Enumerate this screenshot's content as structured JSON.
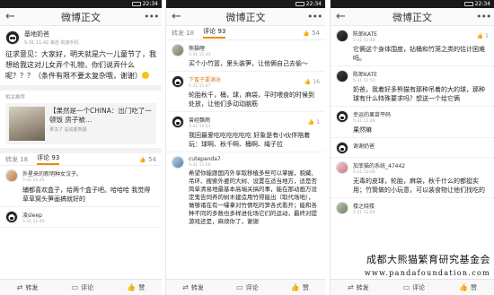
{
  "status_time": "22:34",
  "nav": {
    "title": "微博正文"
  },
  "panel1": {
    "author": {
      "name": "基地奶爸",
      "time": "5-31 11:42  来自 凯旅手机"
    },
    "body": "征求意见：大家好，明天就是六一儿童节了，我想给我这对儿女弄个礼物，你们说弄什么呢？？？（条件有限不要太复杂哦，谢谢）",
    "related_label": "相关推荐",
    "share": {
      "text": "【果然是一个CHINA：出门吃了一顿饭 房子被…",
      "sub": "果冻了 是成都熊猫"
    },
    "tabs": {
      "repost": "转发 18",
      "comment": "评论 93",
      "likes": "54"
    },
    "comments": [
      {
        "name": "外星来的新明种女汉子。",
        "time": "5-31 11:45",
        "text": "",
        "likes": ""
      },
      {
        "name": "",
        "time": "",
        "text": "辅都喜欢盒子，给两个盒子吧。哈哈哈 我觉得草草窝头笋画搞就好的",
        "likes": ""
      },
      {
        "name": "凌sleep",
        "time": "5-31 11:46",
        "text": "",
        "likes": ""
      }
    ]
  },
  "panel2": {
    "tabs": {
      "repost": "转发 18",
      "comment": "评论 93",
      "likes": "54"
    },
    "comments": [
      {
        "name": "熊猫哩",
        "time": "5-31 11:45",
        "text": "买个小竹篮，里头装笋，让他俩自己去偷～",
        "likes": ""
      },
      {
        "name": "下蜜子要满泳",
        "time": "5-31 11:47",
        "text": "",
        "likes": "16"
      },
      {
        "name": "",
        "time": "",
        "text": "轮胎秋千，桶，球，麻袋，平时喂食的时候到处放，让他们多动动脑筋",
        "likes": ""
      },
      {
        "name": "曾经飘雨",
        "time": "5-31 11:51",
        "text": "我回最爱吃吃吃吃吃吃 好象是有小伙伴陪着玩：球啊、秋千啊、桶啊、绳子拉",
        "likes": "1"
      },
      {
        "name": "cutepanda7",
        "time": "5-31 11:56",
        "text": "希望你能跟国内外享取移植多些可以掌握，貌藏、吊环、搜索外婆的大树、设置在适当地方，适是否简单清易地最基本高端关搞的事，能在那动画万设定鬼告饲养的树木建造用竹得能出（取代场地），做够诸在有一嚯拿对竹情吃的笋各式看开；能和各种不同的多数也多样进化场它们的运动，最终对提游戏还是，麻烦你了，谢谢",
        "likes": ""
      }
    ]
  },
  "panel3": {
    "comments": [
      {
        "name": "陈郎KATE",
        "time": "5-31 11:48",
        "text": "它俩这个身体围度，钻桶和竹笼之类的估计困难吗。",
        "likes": "1"
      },
      {
        "name": "陈郎KATE",
        "time": "5-31 11:51",
        "text": "奶爸，我着好多熊猫有那种吊着的大的球，那种球有什么特殊要求吗？想送一个给它俩",
        "likes": ""
      },
      {
        "name": "幸运的果苗平码",
        "time": "5-31 11:48",
        "text": "果然嘛",
        "likes": ""
      },
      {
        "name": "谢谢奶爸",
        "time": "",
        "text": "",
        "likes": ""
      },
      {
        "name": "加菲猫的系统_47442",
        "time": "5-31 12:00",
        "text": "无毒的皮球，轮胎，麻袋，秋千什么的都挺实用；竹筒做的小玩意，可以装食物让他们找吃的",
        "likes": ""
      },
      {
        "name": "楼之晓楼",
        "time": "5-31 12:03",
        "text": "",
        "likes": ""
      }
    ]
  },
  "bottombar": {
    "repost": "转发",
    "comment": "评论",
    "like": "赞"
  },
  "watermark": {
    "cn": "成都大熊猫繁育研究基金会",
    "url": "www.pandafoundation.com"
  },
  "icons": {
    "back": "back-arrow-icon",
    "more": "more-dots-icon",
    "thumb": "thumb-up-icon",
    "repost": "repost-icon",
    "comment": "comment-icon",
    "like": "like-icon"
  }
}
